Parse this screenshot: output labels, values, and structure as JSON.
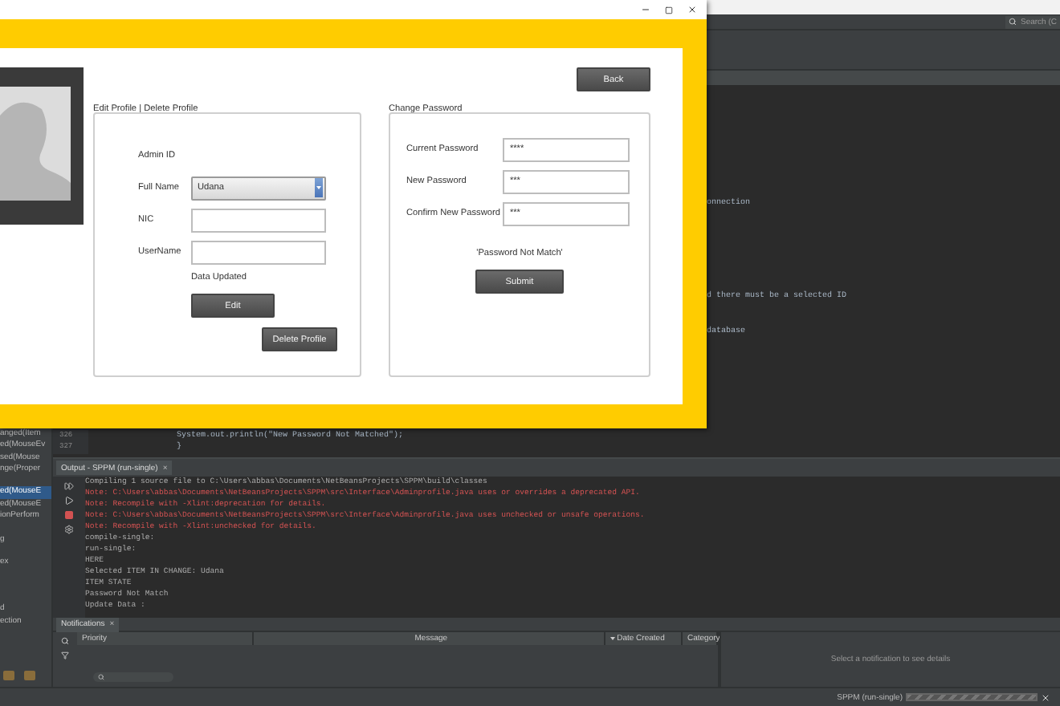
{
  "ide": {
    "search": {
      "placeholder": "Search (C"
    },
    "navigator": [
      {
        "kind": "item",
        "label": "anged(Item",
        "selected": false
      },
      {
        "kind": "item",
        "label": "ed(MouseEv",
        "selected": false
      },
      {
        "kind": "item",
        "label": "sed(Mouse",
        "selected": false
      },
      {
        "kind": "item",
        "label": "nge(Proper",
        "selected": false
      },
      {
        "kind": "blank"
      },
      {
        "kind": "item",
        "label": "ed(MouseE",
        "selected": true
      },
      {
        "kind": "item",
        "label": "ed(MouseE",
        "selected": false
      },
      {
        "kind": "item",
        "label": "ionPerform",
        "selected": false
      },
      {
        "kind": "blank"
      },
      {
        "kind": "item",
        "label": "g",
        "selected": false
      },
      {
        "kind": "blank"
      },
      {
        "kind": "item",
        "label": "ex",
        "selected": false
      },
      {
        "kind": "blank"
      },
      {
        "kind": "blank"
      },
      {
        "kind": "blank"
      },
      {
        "kind": "item",
        "label": "d",
        "selected": false
      },
      {
        "kind": "item",
        "label": "ection",
        "selected": false
      }
    ],
    "editor_lines": [
      {
        "kind": "tail",
        "text": "onnection"
      },
      {
        "kind": "blank"
      },
      {
        "kind": "blank"
      },
      {
        "kind": "blank"
      },
      {
        "kind": "blank"
      },
      {
        "kind": "blank"
      },
      {
        "kind": "blank"
      },
      {
        "kind": "blank"
      },
      {
        "kind": "tail",
        "text": "d there must be a selected ID"
      },
      {
        "kind": "blank"
      },
      {
        "kind": "blank"
      },
      {
        "kind": "tail",
        "text": "database"
      },
      {
        "kind": "blank"
      },
      {
        "kind": "blank"
      },
      {
        "kind": "blank"
      },
      {
        "kind": "blank"
      },
      {
        "kind": "blank"
      },
      {
        "kind": "blank"
      },
      {
        "kind": "blank"
      },
      {
        "kind": "blank"
      },
      {
        "kind": "code",
        "number": "326",
        "text": "System.out.println(\"New Password Not Matched\");"
      },
      {
        "kind": "code",
        "number": "327",
        "text": "}"
      }
    ],
    "output": {
      "tab": "Output - SPPM (run-single)",
      "close": "×",
      "lines": [
        {
          "kind": "info",
          "text": "Compiling 1 source file to C:\\Users\\abbas\\Documents\\NetBeansProjects\\SPPM\\build\\classes"
        },
        {
          "kind": "error",
          "text": "Note: C:\\Users\\abbas\\Documents\\NetBeansProjects\\SPPM\\src\\Interface\\Adminprofile.java uses or overrides a deprecated API."
        },
        {
          "kind": "error",
          "text": "Note: Recompile with -Xlint:deprecation for details."
        },
        {
          "kind": "error",
          "text": "Note: C:\\Users\\abbas\\Documents\\NetBeansProjects\\SPPM\\src\\Interface\\Adminprofile.java uses unchecked or unsafe operations."
        },
        {
          "kind": "error",
          "text": "Note: Recompile with -Xlint:unchecked for details."
        },
        {
          "kind": "info",
          "text": "compile-single:"
        },
        {
          "kind": "info",
          "text": "run-single:"
        },
        {
          "kind": "info",
          "text": "HERE"
        },
        {
          "kind": "info",
          "text": "Selected ITEM  IN CHANGE: Udana"
        },
        {
          "kind": "info",
          "text": "ITEM STATE"
        },
        {
          "kind": "info",
          "text": "Password Not Match"
        },
        {
          "kind": "info",
          "text": "Update Data :"
        }
      ]
    },
    "notifications": {
      "tab": "Notifications",
      "close": "×",
      "columns": [
        {
          "label": "Priority",
          "sorted": false
        },
        {
          "label": "Message",
          "sorted": false
        },
        {
          "label": "Date Created",
          "sorted": true
        },
        {
          "label": "Category",
          "sorted": false
        }
      ],
      "detail": "Select a notification to see details"
    },
    "status_bar": {
      "task": "SPPM (run-single)",
      "level": 1
    }
  },
  "dialog": {
    "back": "Back",
    "edit_section": {
      "title": "Edit Profile | Delete Profile",
      "rows": [
        {
          "kind": "text",
          "label": "Admin ID"
        },
        {
          "kind": "dropdown",
          "label": "Full Name",
          "value": "Udana"
        },
        {
          "kind": "input",
          "label": "NIC"
        },
        {
          "kind": "input",
          "label": "UserName"
        }
      ],
      "message": "Data Updated",
      "edit_button": "Edit",
      "delete_button": "Delete Profile"
    },
    "password_section": {
      "title": "Change Password",
      "rows": [
        {
          "label": "Current Password",
          "value": "****"
        },
        {
          "label": "New Password",
          "value": "***"
        },
        {
          "label": "Confirm New Password",
          "value": "***"
        }
      ],
      "message": "'Password Not Match'",
      "submit": "Submit"
    }
  }
}
